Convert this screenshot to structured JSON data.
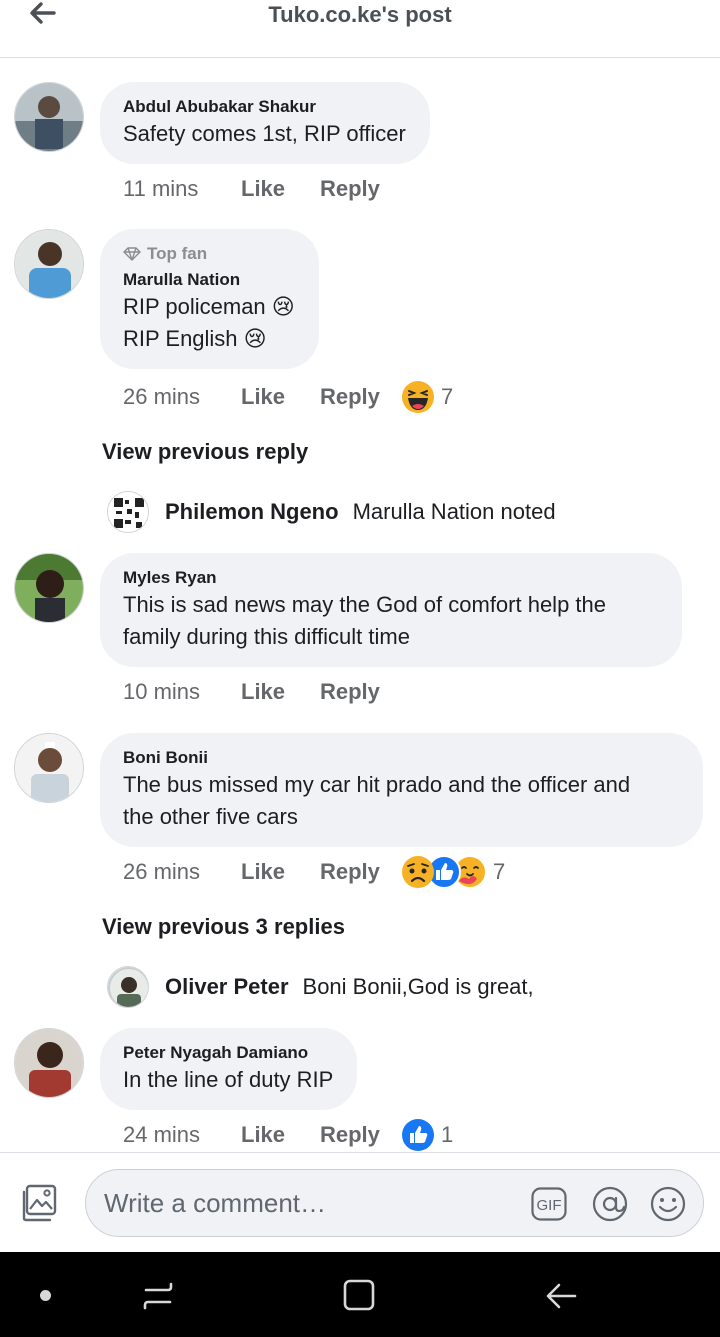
{
  "header": {
    "title": "Tuko.co.ke's post"
  },
  "comments": [
    {
      "author": "Abdul Abubakar Shakur",
      "lines": [
        "Safety comes 1st, RIP officer"
      ],
      "time": "11 mins",
      "like": "Like",
      "reply": "Reply"
    },
    {
      "badge": "Top fan",
      "author": "Marulla Nation",
      "lines": [
        "RIP policeman 😢",
        "RIP English 😢"
      ],
      "time": "26 mins",
      "like": "Like",
      "reply": "Reply",
      "reactions": {
        "count": "7",
        "types": [
          "haha"
        ]
      }
    },
    {
      "author": "Myles Ryan",
      "lines": [
        "This is sad news may the God of comfort  help the",
        "family during this difficult time"
      ],
      "time": "10 mins",
      "like": "Like",
      "reply": "Reply"
    },
    {
      "author": "Boni Bonii",
      "lines": [
        "The bus missed my car hit prado and the officer and",
        "the other five cars"
      ],
      "time": "26 mins",
      "like": "Like",
      "reply": "Reply",
      "reactions": {
        "count": "7",
        "types": [
          "sad",
          "like",
          "care"
        ]
      }
    },
    {
      "author": "Peter Nyagah Damiano",
      "lines": [
        "In the line of duty RIP"
      ],
      "time": "24 mins",
      "like": "Like",
      "reply": "Reply",
      "reactions": {
        "count": "1",
        "types": [
          "like"
        ]
      }
    }
  ],
  "view_previous": [
    "View previous reply",
    "View previous 3 replies"
  ],
  "replies": [
    {
      "author": "Philemon Ngeno",
      "text": "Marulla Nation noted"
    },
    {
      "author": "Oliver Peter",
      "text": "Boni Bonii,God is great,"
    }
  ],
  "composer": {
    "placeholder": "Write a comment…",
    "gif_label": "GIF"
  },
  "colors": {
    "bubble": "#f0f2f5",
    "meta": "#65676b",
    "like_blue": "#1877f2"
  }
}
